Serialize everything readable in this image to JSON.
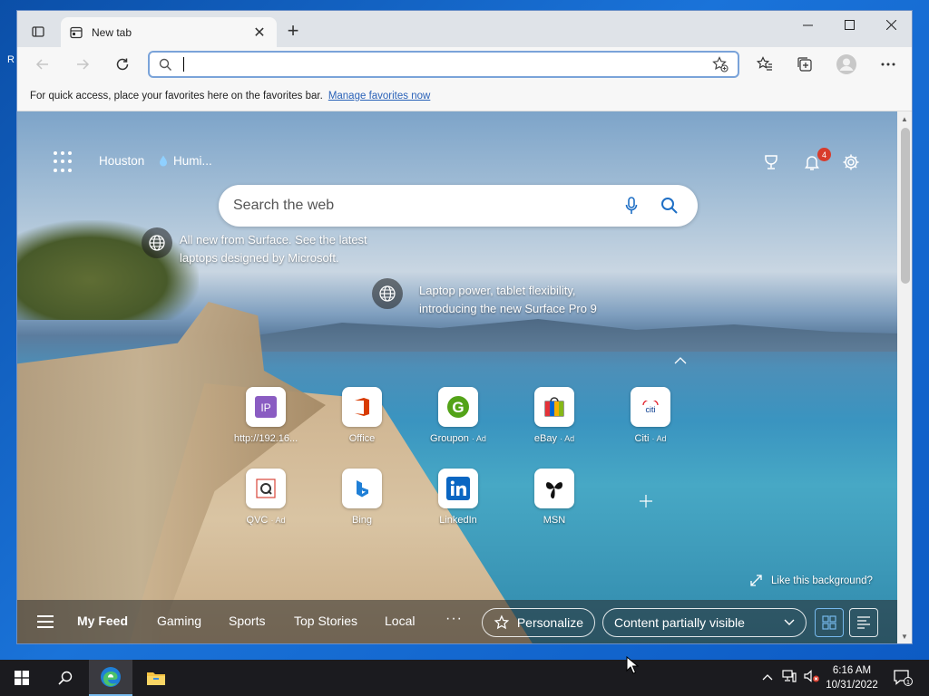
{
  "colors": {
    "accent": "#0078d4",
    "link": "#2a62b8",
    "badge": "#d83b2b",
    "edge_blue": "#1f7fd6"
  },
  "browser": {
    "tab_title": "New tab",
    "address_value": "",
    "favorites_hint": "For quick access, place your favorites here on the favorites bar.",
    "manage_favorites": "Manage favorites now"
  },
  "newtab": {
    "weather_city": "Houston",
    "weather_condition": "Humi...",
    "notification_count": "4",
    "search_placeholder": "Search the web",
    "hotspots": [
      {
        "text": "All new from Surface. See the latest laptops designed by Microsoft."
      },
      {
        "text": "Laptop power, tablet flexibility, introducing the new Surface Pro 9"
      }
    ],
    "quick_links": [
      {
        "label": "http://192.16...",
        "ad": "",
        "icon": "ip-icon"
      },
      {
        "label": "Office",
        "ad": "",
        "icon": "office-icon"
      },
      {
        "label": "Groupon",
        "ad": "· Ad",
        "icon": "groupon-icon"
      },
      {
        "label": "eBay",
        "ad": "· Ad",
        "icon": "ebay-icon"
      },
      {
        "label": "Citi",
        "ad": "· Ad",
        "icon": "citi-icon"
      },
      {
        "label": "QVC",
        "ad": "· Ad",
        "icon": "qvc-icon"
      },
      {
        "label": "Bing",
        "ad": "",
        "icon": "bing-icon"
      },
      {
        "label": "LinkedIn",
        "ad": "",
        "icon": "linkedin-icon"
      },
      {
        "label": "MSN",
        "ad": "",
        "icon": "msn-icon"
      }
    ],
    "like_background": "Like this background?",
    "feed_tabs": [
      "My Feed",
      "Gaming",
      "Sports",
      "Top Stories",
      "Local"
    ],
    "more": "···",
    "personalize": "Personalize",
    "content_visibility": "Content partially visible"
  },
  "taskbar": {
    "time": "6:16 AM",
    "date": "10/31/2022",
    "notification_count": "1"
  }
}
